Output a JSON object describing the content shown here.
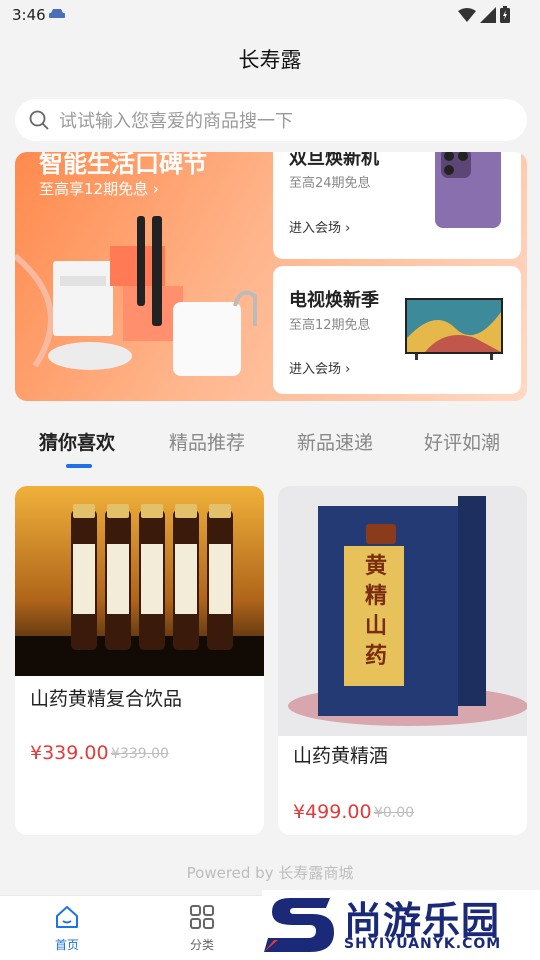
{
  "status_bar": {
    "time": "3:46"
  },
  "header": {
    "title": "长寿露"
  },
  "search": {
    "placeholder": "试试输入您喜爱的商品搜一下"
  },
  "banner": {
    "main_title": "智能生活口碑节",
    "main_subtitle": "至高享12期免息 ›",
    "cards": [
      {
        "title": "双旦焕新机",
        "subtitle": "至高24期免息",
        "action": "进入会场 ›"
      },
      {
        "title": "电视焕新季",
        "subtitle": "至高12期免息",
        "action": "进入会场 ›"
      }
    ]
  },
  "tabs": [
    "猜你喜欢",
    "精品推荐",
    "新品速递",
    "好评如潮"
  ],
  "active_tab": "猜你喜欢",
  "products": [
    {
      "name": "山药黄精复合饮品",
      "price": "¥339.00",
      "original_price": "¥339.00",
      "box_text": ""
    },
    {
      "name": "山药黄精酒",
      "price": "¥499.00",
      "original_price": "¥0.00",
      "box_text": "黄精山药"
    }
  ],
  "footer": {
    "powered": "Powered by 长寿露商城"
  },
  "bottom_nav": [
    {
      "label": "首页",
      "icon": "home-icon",
      "active": true
    },
    {
      "label": "分类",
      "icon": "grid-icon",
      "active": false
    }
  ],
  "watermark": {
    "text": "尚游乐园",
    "url": "SHYIYUANYK.COM"
  },
  "colors": {
    "accent": "#1e72e8",
    "price": "#e43a3a",
    "banner": "#ff8a4d"
  }
}
